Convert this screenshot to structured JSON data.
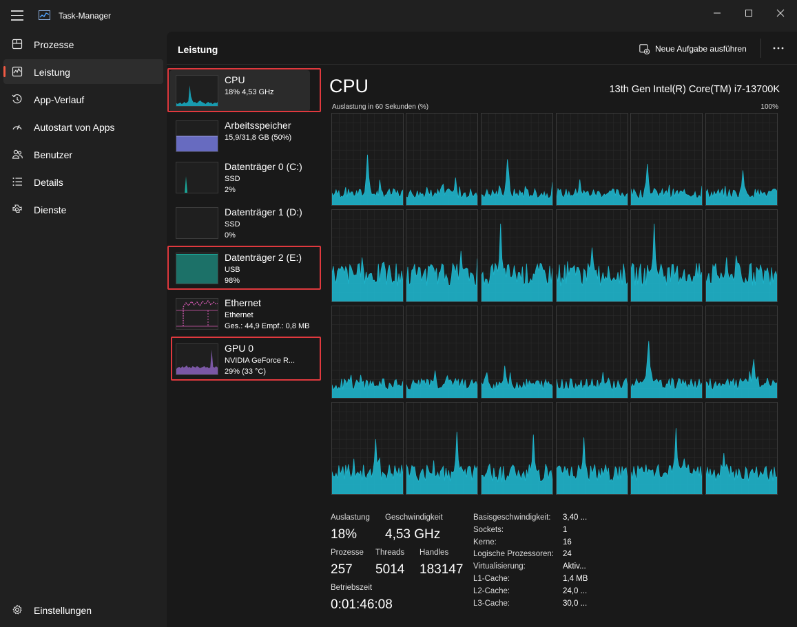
{
  "window": {
    "title": "Task-Manager"
  },
  "nav": {
    "items": [
      {
        "label": "Prozesse",
        "icon": "processes-icon"
      },
      {
        "label": "Leistung",
        "icon": "performance-icon",
        "active": true
      },
      {
        "label": "App-Verlauf",
        "icon": "history-icon"
      },
      {
        "label": "Autostart von Apps",
        "icon": "startup-icon"
      },
      {
        "label": "Benutzer",
        "icon": "users-icon"
      },
      {
        "label": "Details",
        "icon": "details-icon"
      },
      {
        "label": "Dienste",
        "icon": "services-icon"
      }
    ],
    "settings_label": "Einstellungen"
  },
  "header": {
    "title": "Leistung",
    "new_task_label": "Neue Aufgabe ausführen"
  },
  "resources": [
    {
      "name": "CPU",
      "line1": "18% 4,53 GHz",
      "line2": "",
      "color": "#17b2c9",
      "selected": true,
      "highlighted": true
    },
    {
      "name": "Arbeitsspeicher",
      "line1": "15,9/31,8 GB (50%)",
      "line2": "",
      "color": "#6f73d2",
      "highlighted": false
    },
    {
      "name": "Datenträger 0 (C:)",
      "line1": "SSD",
      "line2": "2%",
      "color": "#1aa89a",
      "highlighted": false
    },
    {
      "name": "Datenträger 1 (D:)",
      "line1": "SSD",
      "line2": "0%",
      "color": "#1aa89a",
      "highlighted": false
    },
    {
      "name": "Datenträger 2 (E:)",
      "line1": "USB",
      "line2": "98%",
      "color": "#1aa89a",
      "highlighted": true
    },
    {
      "name": "Ethernet",
      "line1": "Ethernet",
      "line2": "Ges.: 44,9 Empf.: 0,8 MB",
      "color": "#d75bb5",
      "highlighted": false
    },
    {
      "name": "GPU 0",
      "line1": "NVIDIA GeForce R...",
      "line2": "29% (33 °C)",
      "color": "#9a6bd2",
      "highlighted": true
    }
  ],
  "cpu": {
    "title": "CPU",
    "model": "13th Gen Intel(R) Core(TM) i7-13700K",
    "graph_caption": "Auslastung in 60 Sekunden (%)",
    "graph_max": "100%",
    "graph_color": "#1fb5cc",
    "stats": {
      "utilization_label": "Auslastung",
      "utilization": "18%",
      "speed_label": "Geschwindigkeit",
      "speed": "4,53 GHz",
      "processes_label": "Prozesse",
      "processes": "257",
      "threads_label": "Threads",
      "threads": "5014",
      "handles_label": "Handles",
      "handles": "183147",
      "uptime_label": "Betriebszeit",
      "uptime": "0:01:46:08"
    },
    "details": [
      {
        "key": "Basisgeschwindigkeit:",
        "value": "3,40 ..."
      },
      {
        "key": "Sockets:",
        "value": "1"
      },
      {
        "key": "Kerne:",
        "value": "16"
      },
      {
        "key": "Logische Prozessoren:",
        "value": "24"
      },
      {
        "key": "Virtualisierung:",
        "value": "Aktiv..."
      },
      {
        "key": "L1-Cache:",
        "value": "1,4 MB"
      },
      {
        "key": "L2-Cache:",
        "value": "24,0 ..."
      },
      {
        "key": "L3-Cache:",
        "value": "30,0 ..."
      }
    ]
  }
}
